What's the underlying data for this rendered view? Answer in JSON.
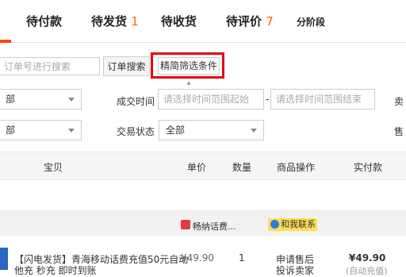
{
  "tabs": [
    {
      "label": "待付款",
      "count": ""
    },
    {
      "label": "待发货",
      "count": "1"
    },
    {
      "label": "待收货",
      "count": ""
    },
    {
      "label": "待评价",
      "count": "7"
    },
    {
      "label": "分阶段",
      "count": ""
    }
  ],
  "search": {
    "order_placeholder": "订单号进行搜索",
    "order_button": "订单搜索",
    "advanced_filter": "精简筛选条件"
  },
  "filters": {
    "row1_select_partial": "部",
    "deal_time_label": "成交时间",
    "start_placeholder": "请选择时间范围起始",
    "range_sep": "-",
    "end_placeholder": "请选择时间范围结束",
    "seller_label_partial": "卖",
    "row2_select_partial": "部",
    "status_label": "交易状态",
    "status_value": "全部",
    "aftersale_label_partial": "售"
  },
  "table_header": {
    "item": "宝贝",
    "price": "单价",
    "qty": "数量",
    "ops": "商品操作",
    "paid": "实付款"
  },
  "order": {
    "shop_name": "畅纳话费...",
    "chat_label": "和我联系",
    "title_line1": "【闪电发货】青海移动话费充值50元自动",
    "title_line2": "他充 秒充 即时到账",
    "unit_price": "¥49.90",
    "quantity": "1",
    "op_line1": "申请售后",
    "op_line2": "投诉卖家",
    "paid_amount": "¥49.90",
    "paid_note": "(自动充值)"
  },
  "colors": {
    "accent": "#ff4400",
    "highlight": "#e60012",
    "count": "#ff6600"
  }
}
